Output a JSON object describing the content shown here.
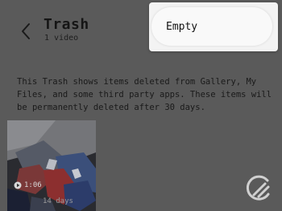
{
  "header": {
    "title": "Trash",
    "subtitle": "1 video",
    "back_icon": "chevron-left-icon"
  },
  "menu": {
    "items": [
      {
        "label": "Empty"
      }
    ]
  },
  "info_text": "This Trash shows items deleted from Gallery, My Files, and some third party apps. These items will be permanently deleted after 30 days.",
  "items": [
    {
      "type": "video",
      "duration": "1:06",
      "days_left": "14 days",
      "icon": "video-play-icon"
    }
  ],
  "watermark": {
    "icon": "brand-logo-icon"
  },
  "colors": {
    "dim_background": "#5a5a5a",
    "menu_background": "#f3f3f3"
  }
}
